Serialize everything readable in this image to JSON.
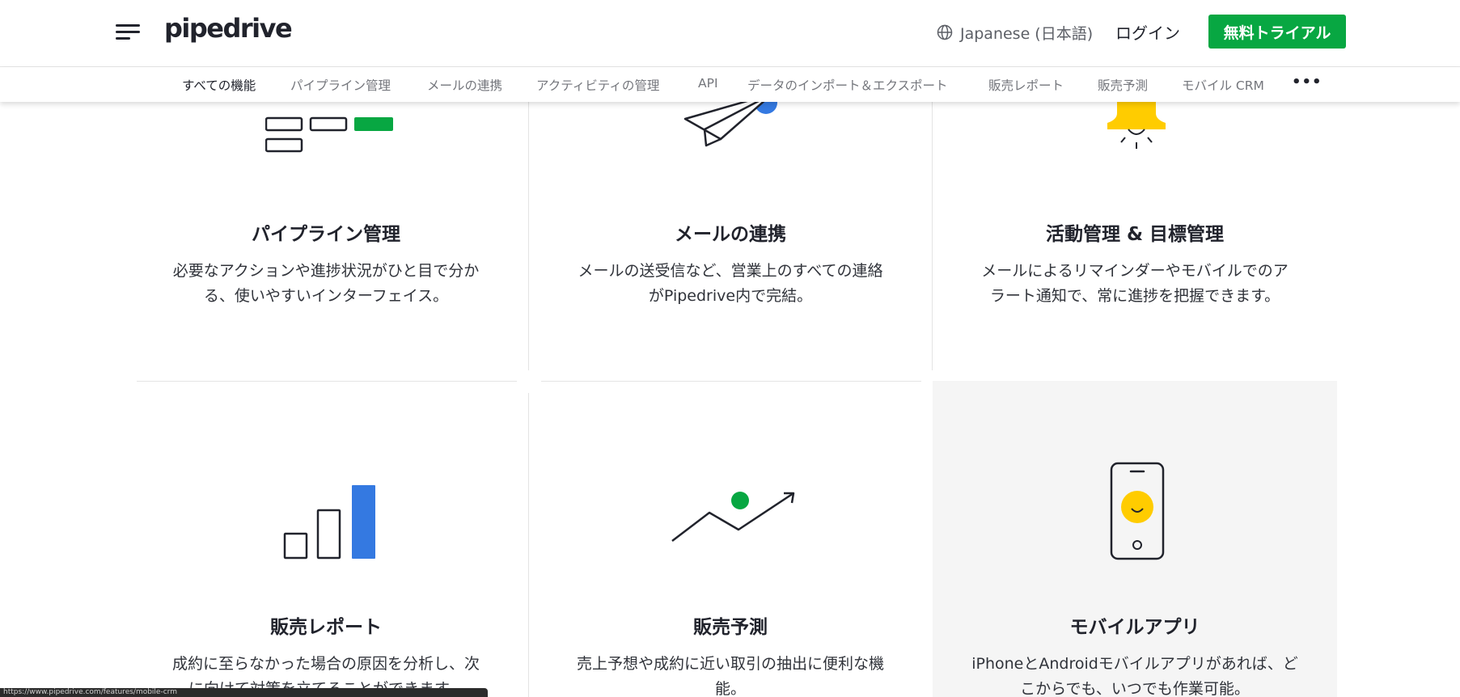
{
  "header": {
    "logo": "pipedrive",
    "language": "Japanese (日本語)",
    "login": "ログイン",
    "trial_button": "無料トライアル",
    "accent_color": "#08a742"
  },
  "feature_nav": {
    "items": [
      {
        "label": "すべての機能",
        "active": true
      },
      {
        "label": "パイプライン管理"
      },
      {
        "label": "メールの連携"
      },
      {
        "label": "アクティビティの管理"
      },
      {
        "label": "API"
      },
      {
        "label": "データのインポート＆エクスポート"
      },
      {
        "label": "販売レポート"
      },
      {
        "label": "販売予測"
      },
      {
        "label": "モバイル CRM"
      }
    ],
    "more_label": "•••"
  },
  "features": [
    {
      "title": "パイプライン管理",
      "desc_line1": "必要なアクションや進捗状況がひと目で分か",
      "desc_line2": "る、使いやすいインターフェイス。",
      "icon": "pipeline-icon"
    },
    {
      "title": "メールの連携",
      "desc_line1": "メールの送受信など、営業上のすべての連絡",
      "desc_line2": "がPipedrive内で完結。",
      "icon": "paper-plane-icon"
    },
    {
      "title": "活動管理 & 目標管理",
      "desc_line1": "メールによるリマインダーやモバイルでのア",
      "desc_line2": "ラート通知で、常に進捗を把握できます。",
      "icon": "bell-icon"
    },
    {
      "title": "販売レポート",
      "desc_line1": "成約に至らなかった場合の原因を分析し、次",
      "desc_line2": "に向けて対策を立てることができます。",
      "icon": "bar-chart-icon"
    },
    {
      "title": "販売予測",
      "desc_line1": "売上予想や成約に近い取引の抽出に便利な機",
      "desc_line2": "能。",
      "icon": "trend-line-icon"
    },
    {
      "title": "モバイルアプリ",
      "desc_line1": "iPhoneとAndroidモバイルアプリがあれば、ど",
      "desc_line2": "こからでも、いつでも作業可能。",
      "icon": "mobile-phone-icon"
    }
  ],
  "status_url": "https://www.pipedrive.com/features/mobile-crm"
}
